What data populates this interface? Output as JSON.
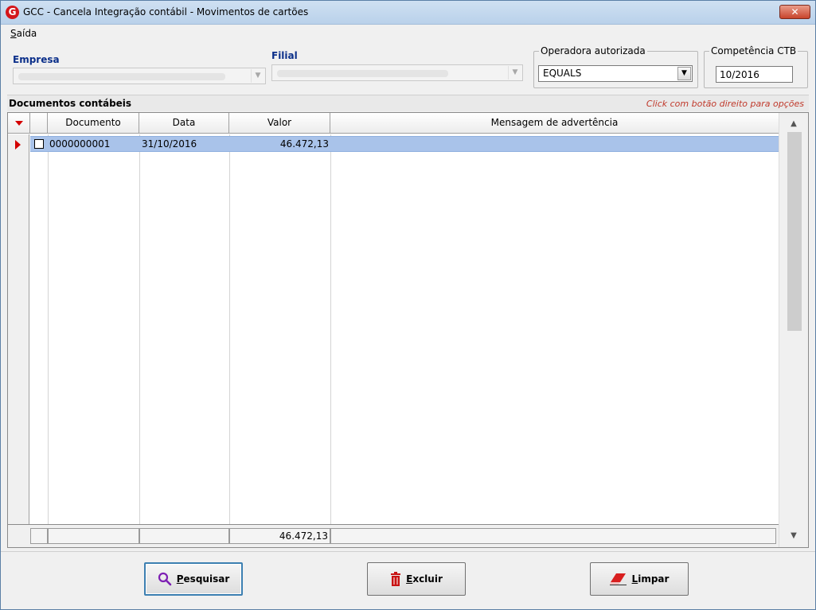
{
  "window": {
    "title": "GCC - Cancela Integração contábil - Movimentos de cartões",
    "close_glyph": "✕"
  },
  "menu": {
    "saida_prefix": "S",
    "saida_rest": "aída"
  },
  "filters": {
    "empresa_label": "Empresa",
    "filial_label": "Filial",
    "operadora_legend": "Operadora autorizada",
    "operadora_value": "EQUALS",
    "competencia_legend": "Competência CTB",
    "competencia_value": "10/2016"
  },
  "panel": {
    "title": "Documentos contábeis",
    "hint": "Click com botão direito para opções"
  },
  "table": {
    "columns": [
      "Documento",
      "Data",
      "Valor",
      "Mensagem de advertência"
    ],
    "rows": [
      {
        "documento": "0000000001",
        "data": "31/10/2016",
        "valor": "46.472,13",
        "mensagem": ""
      }
    ],
    "total_valor": "46.472,13"
  },
  "buttons": {
    "pesquisar_prefix": "P",
    "pesquisar_rest": "esquisar",
    "excluir_prefix": "E",
    "excluir_rest": "xcluir",
    "limpar_prefix": "L",
    "limpar_rest": "impar"
  },
  "colors": {
    "accent_red": "#d40000",
    "selection": "#a9c3ea",
    "label_blue": "#0b2f8a"
  }
}
